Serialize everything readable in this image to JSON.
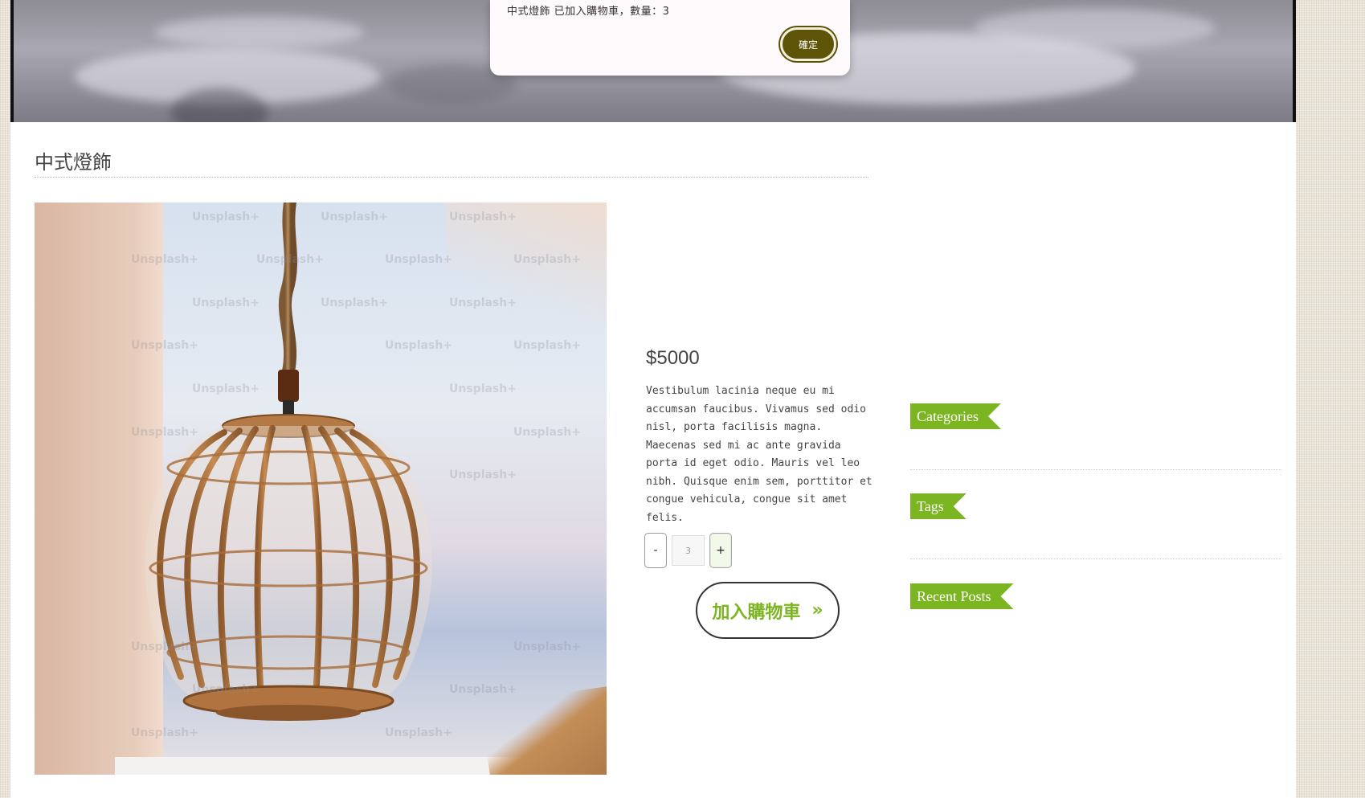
{
  "dialog": {
    "message": "中式燈飾 已加入購物車，數量：3",
    "ok_label": "確定"
  },
  "product": {
    "title": "中式燈飾",
    "price": "$5000",
    "description": "Vestibulum lacinia neque eu mi accumsan faucibus. Vivamus sed odio nisl, porta facilisis magna. Maecenas sed mi ac ante gravida porta id eget odio. Mauris vel leo nibh. Quisque enim sem, porttitor et congue vehicula, congue sit amet felis.",
    "quantity": "3",
    "minus_label": "-",
    "plus_label": "+",
    "add_to_cart_label": "加入購物車",
    "add_to_cart_arrow": "»",
    "image_watermark": "Unsplash+"
  },
  "sidebar": {
    "categories": "Categories",
    "tags": "Tags",
    "recent_posts": "Recent Posts"
  },
  "colors": {
    "accent_green": "#7bb521",
    "dialog_button": "#5e5408"
  }
}
